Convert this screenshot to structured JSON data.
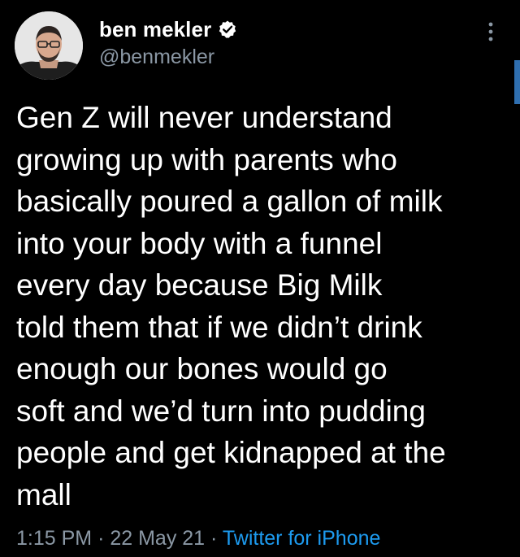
{
  "author": {
    "display_name": "ben mekler",
    "handle": "@benmekler",
    "verified_icon": "verified-badge-icon"
  },
  "tweet": {
    "text": "Gen Z will never understand\ngrowing up with parents who\nbasically poured a gallon of milk\ninto your body with a funnel\nevery day because Big Milk\ntold them that if we didn’t drink\nenough our bones would go\nsoft and we’d turn into pudding\npeople and get kidnapped at the\nmall",
    "time": "1:15 PM",
    "separator": "·",
    "date": "22 May 21",
    "source": "Twitter for iPhone"
  },
  "icons": {
    "more": "more-vertical-icon"
  },
  "colors": {
    "background": "#000000",
    "primary_text": "#ffffff",
    "secondary_text": "#8b98a5",
    "link": "#1d9bf0"
  }
}
